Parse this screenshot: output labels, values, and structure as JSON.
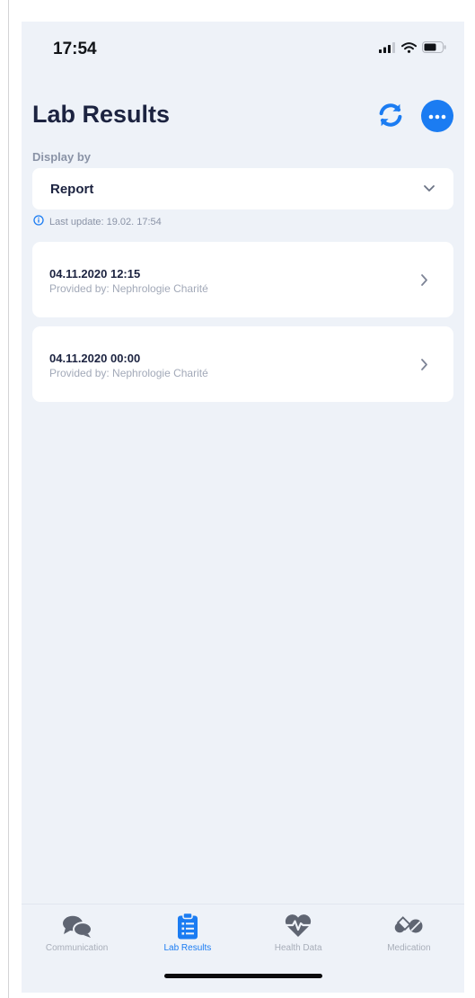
{
  "status_bar": {
    "time": "17:54",
    "icons": [
      "cellular-signal-icon",
      "wifi-icon",
      "battery-icon"
    ]
  },
  "header": {
    "title": "Lab Results",
    "refresh_icon": "refresh-icon",
    "more_icon": "more-options-icon"
  },
  "display_by": {
    "label": "Display by",
    "selected": "Report"
  },
  "last_update": "Last update: 19.02. 17:54",
  "reports": [
    {
      "date": "04.11.2020 12:15",
      "provider": "Provided by: Nephrologie Charité"
    },
    {
      "date": "04.11.2020 00:00",
      "provider": "Provided by: Nephrologie Charité"
    }
  ],
  "tab_bar": {
    "tabs": [
      {
        "label": "Communication",
        "icon": "chat-bubbles-icon",
        "active": false
      },
      {
        "label": "Lab Results",
        "icon": "clipboard-list-icon",
        "active": true
      },
      {
        "label": "Health Data",
        "icon": "heartbeat-icon",
        "active": false
      },
      {
        "label": "Medication",
        "icon": "pills-icon",
        "active": false
      }
    ]
  },
  "colors": {
    "accent": "#1b7cf2",
    "background": "#eef2f8",
    "title": "#1c2340",
    "muted": "#8a93a6"
  }
}
